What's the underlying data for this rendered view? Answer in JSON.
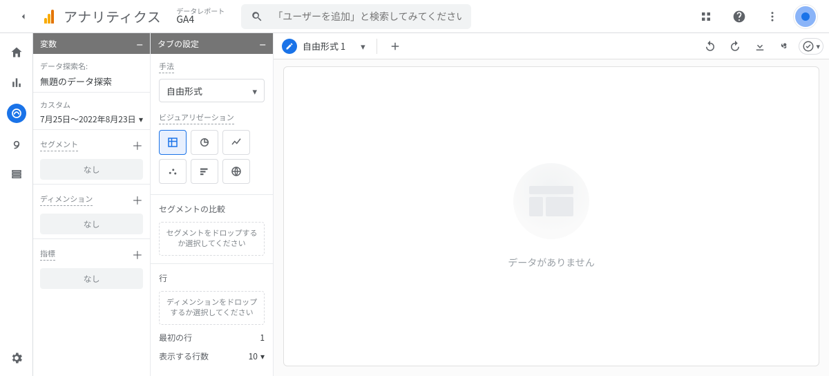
{
  "header": {
    "product": "アナリティクス",
    "property_label": "データレポート",
    "property_name": "GA4",
    "search_placeholder": "「ユーザーを追加」と検索してみてください"
  },
  "var_panel": {
    "title": "変数",
    "name_label": "データ探索名:",
    "name_value": "無題のデータ探索",
    "range_label": "カスタム",
    "range_value": "7月25日～2022年8月23日",
    "segment_label": "セグメント",
    "dimension_label": "ディメンション",
    "metric_label": "指標",
    "none": "なし"
  },
  "tab_panel": {
    "title": "タブの設定",
    "technique_label": "手法",
    "technique_value": "自由形式",
    "viz_label": "ビジュアリゼーション",
    "seg_comp_label": "セグメントの比較",
    "seg_comp_drop": "セグメントをドロップするか選択してください",
    "rows_label": "行",
    "rows_drop": "ディメンションをドロップするか選択してください",
    "first_row_label": "最初の行",
    "first_row_value": "1",
    "show_rows_label": "表示する行数",
    "show_rows_value": "10"
  },
  "canvas": {
    "tab_name": "自由形式 1",
    "empty": "データがありません"
  }
}
